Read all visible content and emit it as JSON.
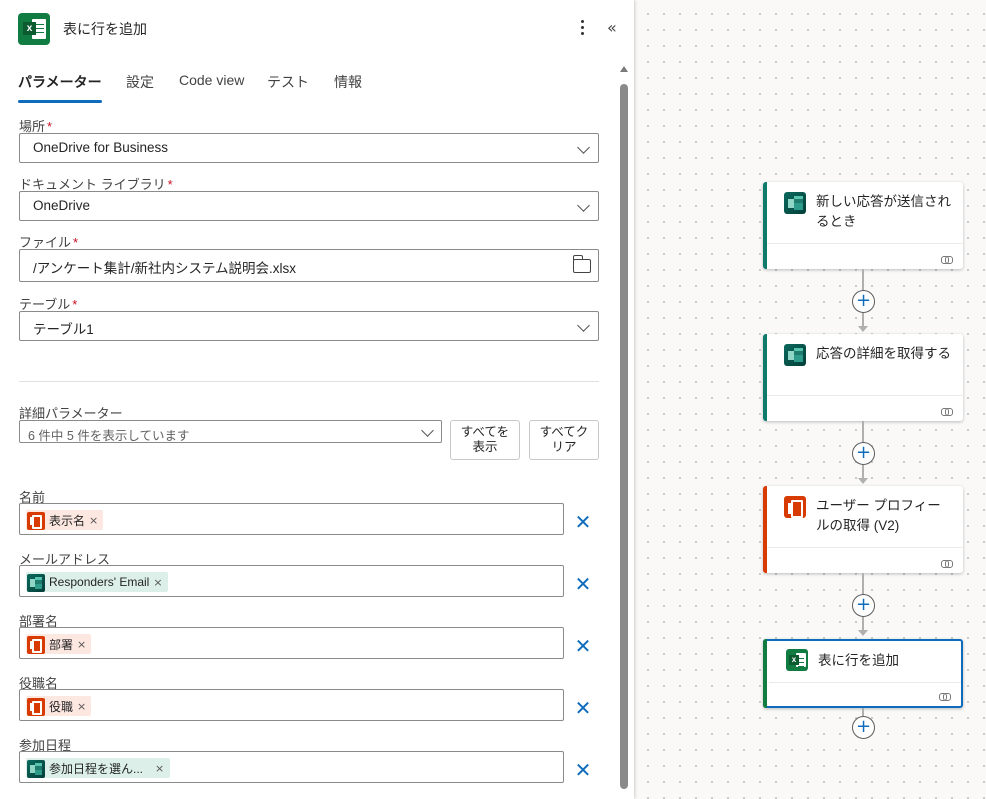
{
  "panel": {
    "title": "表に行を追加",
    "tabs": [
      {
        "label": "パラメーター",
        "active": true
      },
      {
        "label": "設定"
      },
      {
        "label": "Code view"
      },
      {
        "label": "テスト"
      },
      {
        "label": "情報"
      }
    ],
    "required_mark": "*",
    "location": {
      "label": "場所",
      "value": "OneDrive for Business"
    },
    "library": {
      "label": "ドキュメント ライブラリ",
      "value": "OneDrive"
    },
    "file": {
      "label": "ファイル",
      "value": "/アンケート集計/新社内システム説明会.xlsx"
    },
    "table": {
      "label": "テーブル",
      "value": "テーブル1"
    },
    "advanced": {
      "label": "詳細パラメーター",
      "summary": "6 件中 5 件を表示しています",
      "show_all_label": "すべてを\n表示",
      "clear_all_label": "すべてクリア"
    },
    "params": [
      {
        "label": "名前",
        "token": "表示名",
        "source": "office"
      },
      {
        "label": "メールアドレス",
        "token": "Responders' Email",
        "source": "forms"
      },
      {
        "label": "部署名",
        "token": "部署",
        "source": "office"
      },
      {
        "label": "役職名",
        "token": "役職",
        "source": "office"
      },
      {
        "label": "参加日程",
        "token": "参加日程を選ん...",
        "source": "forms"
      }
    ],
    "token_remove": "×"
  },
  "flow": {
    "cards": [
      {
        "title": "新しい応答が送信されるとき",
        "icon": "forms-icon",
        "accent": "#0e7a6b"
      },
      {
        "title": "応答の詳細を取得する",
        "icon": "forms-icon",
        "accent": "#0e7a6b"
      },
      {
        "title": "ユーザー プロフィールの取得 (V2)",
        "icon": "office-icon",
        "accent": "#d83b01"
      },
      {
        "title": "表に行を追加",
        "icon": "excel-icon",
        "accent": "#107c41"
      }
    ],
    "plus": "+"
  },
  "colors": {
    "accent": "#0f6cbd",
    "excel": "#107c41",
    "office": "#d83b01",
    "forms": "#0e7a6b"
  }
}
